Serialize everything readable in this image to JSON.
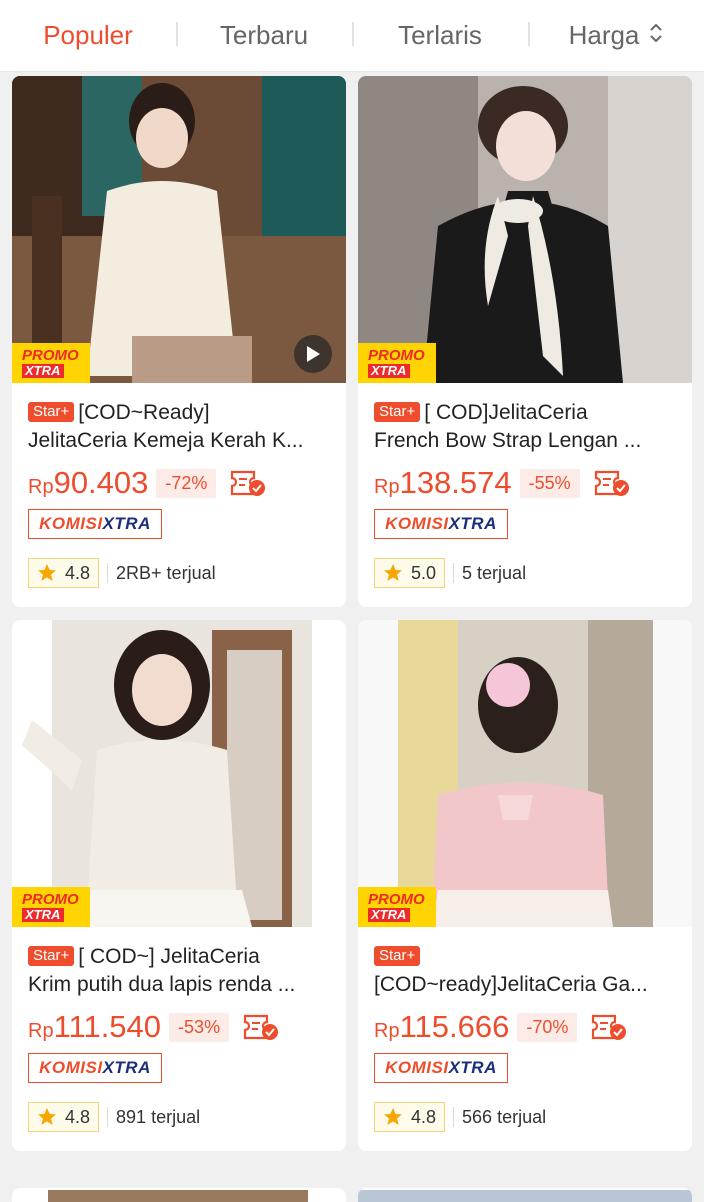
{
  "sort": {
    "tabs": [
      {
        "label": "Populer",
        "active": true
      },
      {
        "label": "Terbaru",
        "active": false
      },
      {
        "label": "Terlaris",
        "active": false
      },
      {
        "label": "Harga",
        "active": false
      }
    ]
  },
  "colors": {
    "accent": "#ee4d2d",
    "promo_yellow": "#ffd400",
    "komisi_blue": "#1b2f7a"
  },
  "promo_badge": {
    "line1": "PROMO",
    "line2": "XTRA"
  },
  "komisi_badge": {
    "part1": "KOMISI",
    "part2": "XTRA"
  },
  "products": [
    {
      "badge": "Star+",
      "title_line1": "[COD~Ready]",
      "title_line2": "JelitaCeria Kemeja Kerah K...",
      "currency": "Rp",
      "price": "90.403",
      "discount": "-72%",
      "rating": "4.8",
      "sold": "2RB+ terjual",
      "has_video": true
    },
    {
      "badge": "Star+",
      "title_line1": "[ COD]JelitaCeria",
      "title_line2": "French Bow Strap Lengan ...",
      "currency": "Rp",
      "price": "138.574",
      "discount": "-55%",
      "rating": "5.0",
      "sold": "5 terjual",
      "has_video": false
    },
    {
      "badge": "Star+",
      "title_line1": "[ COD~] JelitaCeria",
      "title_line2": "Krim putih dua lapis renda ...",
      "currency": "Rp",
      "price": "111.540",
      "discount": "-53%",
      "rating": "4.8",
      "sold": "891 terjual",
      "has_video": false
    },
    {
      "badge": "Star+",
      "title_line1": "",
      "title_line2": "[COD~ready]JelitaCeria Ga...",
      "currency": "Rp",
      "price": "115.666",
      "discount": "-70%",
      "rating": "4.8",
      "sold": "566 terjual",
      "has_video": false
    }
  ]
}
